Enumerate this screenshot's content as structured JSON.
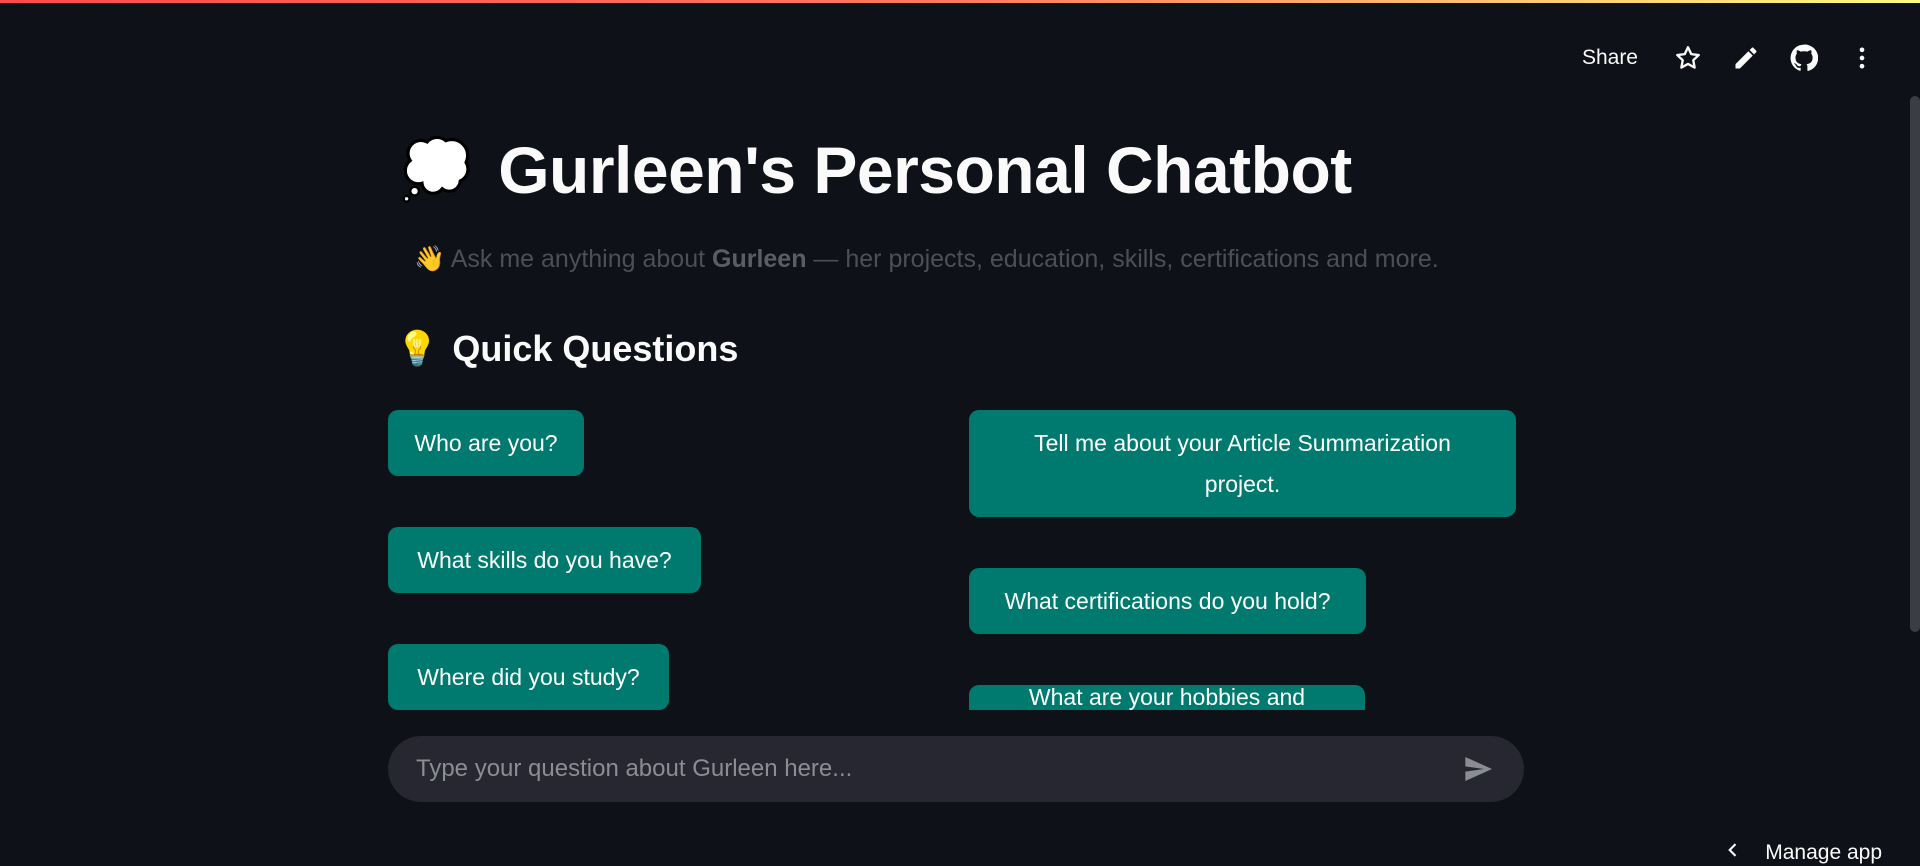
{
  "toolbar": {
    "share_label": "Share",
    "icons": [
      "star-icon",
      "pencil-icon",
      "github-icon",
      "more-vertical-icon"
    ]
  },
  "header": {
    "title_emoji": "💭",
    "title": "Gurleen's Personal Chatbot",
    "subtitle_emoji": "👋",
    "subtitle_pre": "Ask me anything about ",
    "subtitle_name": "Gurleen",
    "subtitle_post": " — her projects, education, skills, certifications and more."
  },
  "quick_questions": {
    "emoji": "💡",
    "heading": "Quick Questions",
    "left": [
      "Who are you?",
      "What skills do you have?",
      "Where did you study?"
    ],
    "right": [
      "Tell me about your Article Summarization project.",
      "What certifications do you hold?",
      "What are your hobbies and interests?"
    ]
  },
  "chat_input": {
    "placeholder": "Type your question about Gurleen here..."
  },
  "footer": {
    "manage_app_label": "Manage app"
  },
  "colors": {
    "background": "#0e1117",
    "button": "#007a6e",
    "input_bg": "#262730"
  }
}
